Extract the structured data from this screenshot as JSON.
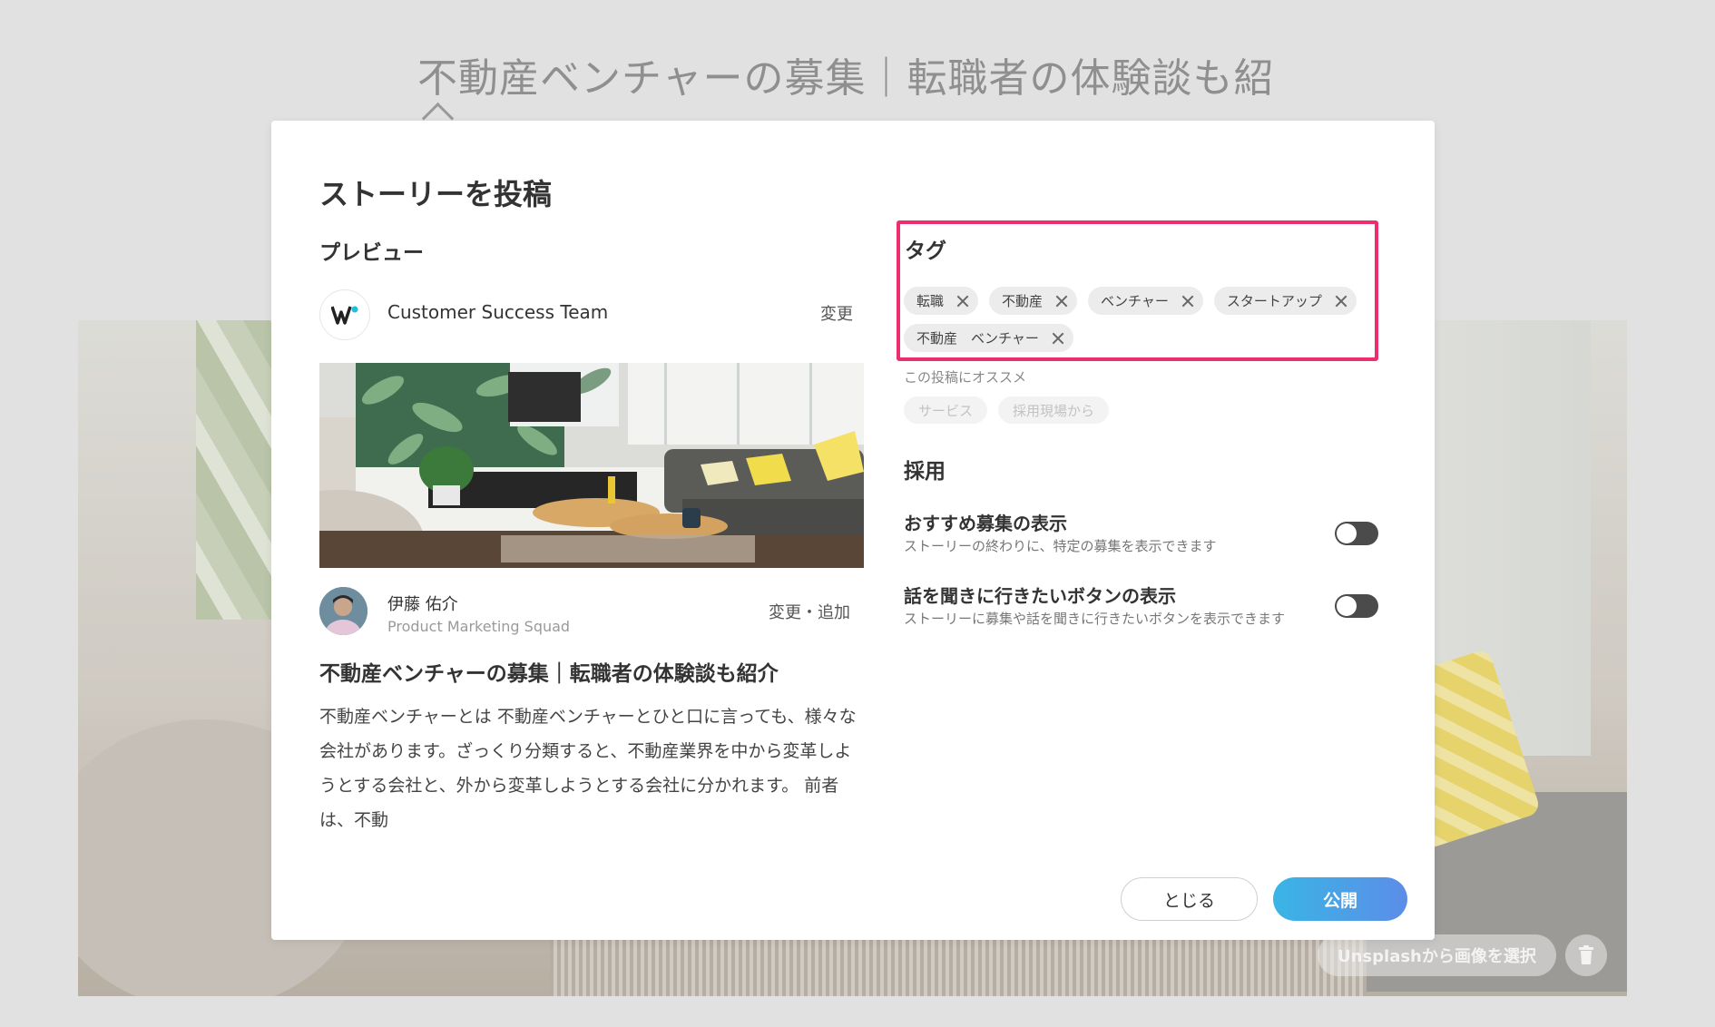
{
  "background": {
    "title": "不動産ベンチャーの募集｜転職者の体験談も紹",
    "unsplash_label": "Unsplashから画像を選択"
  },
  "modal": {
    "title": "ストーリーを投稿",
    "preview": {
      "label": "プレビュー",
      "org_name": "Customer Success Team",
      "org_change": "変更",
      "author_name": "伊藤 佑介",
      "author_team": "Product Marketing Squad",
      "author_change": "変更・追加",
      "story_title": "不動産ベンチャーの募集｜転職者の体験談も紹介",
      "excerpt": "不動産ベンチャーとは 不動産ベンチャーとひと口に言っても、様々な会社があります。ざっくり分類すると、不動産業界を中から変革しようとする会社と、外から変革しようとする会社に分かれます。 前者は、不動"
    },
    "tags": {
      "label": "タグ",
      "items": [
        "転職",
        "不動産",
        "ベンチャー",
        "スタートアップ",
        "不動産　ベンチャー"
      ],
      "recommend_label": "この投稿にオススメ",
      "recommend_items": [
        "サービス",
        "採用現場から"
      ],
      "highlight_color": "#ec2d6e"
    },
    "hiring": {
      "label": "採用",
      "settings": [
        {
          "title": "おすすめ募集の表示",
          "desc": "ストーリーの終わりに、特定の募集を表示できます",
          "enabled": false
        },
        {
          "title": "話を聞きに行きたいボタンの表示",
          "desc": "ストーリーに募集や話を聞きに行きたいボタンを表示できます",
          "enabled": false
        }
      ]
    },
    "buttons": {
      "close": "とじる",
      "publish": "公開"
    }
  }
}
